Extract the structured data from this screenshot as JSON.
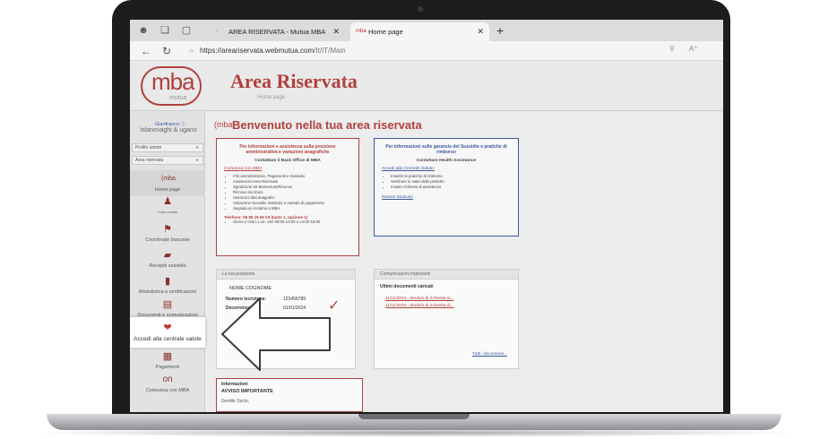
{
  "browser": {
    "tabs": [
      {
        "label": "AREA RISERVATA - Mutua MBA",
        "active": false
      },
      {
        "label": "Home page",
        "active": true
      }
    ],
    "url_domain": "https://areariservata.webmutua.com",
    "url_path": "/It/IT/Main"
  },
  "header": {
    "logo_text": "mba",
    "logo_sub": "mutua",
    "title": "Area Riservata",
    "subtitle": "Home page"
  },
  "sidebar": {
    "user_name": "Gianfranco ⓘ",
    "user_org": "Islanovaghi & ugano",
    "select_profile": "Profilo utente",
    "select_area": "Area riservata",
    "items": [
      {
        "label": "Home page",
        "icon": "mba-icon"
      },
      {
        "label": "Il mio nucleo",
        "icon": "people-icon"
      },
      {
        "label": "Coordinate bancarie",
        "icon": "bank-icon"
      },
      {
        "label": "Recapiti sussidio",
        "icon": "money-icon"
      },
      {
        "label": "Modulistica e certificazioni",
        "icon": "document-icon"
      },
      {
        "label": "Documenti e comunicazioni",
        "icon": "folder-icon"
      },
      {
        "label": "Accedi alla centrale salute",
        "icon": "health-icon"
      },
      {
        "label": "Pagamenti",
        "icon": "payment-icon"
      },
      {
        "label": "Comunica con MBA",
        "icon": "chat-icon"
      }
    ]
  },
  "content": {
    "welcome": "Benvenuto nella tua area riservata",
    "box_red": {
      "title": "Per informazioni e assistenza sulla posizione amministrativa e variazioni anagrafiche",
      "subtitle": "Contattare il Back Office di MBA",
      "link": "Comunica con MBA",
      "bullets": [
        "Info amministrative, Pagamenti e Sussidio",
        "Assistenza Area Riservata",
        "Spedizione Kit Benvenuto/Rinnovo",
        "Rinnovo iscrizioni",
        "Variazioni dati anagrafici",
        "Variazione Sussidio Sanitario e metodo di pagamento",
        "Segnala un reclamo a MBA"
      ],
      "phone": "Telefono: 06 86 19 65 03 (tasto 1, opzione 1)",
      "hours": "Giorni e Orari: Lun- Ven 09:00-13:00 e 14:00-18:00"
    },
    "box_blue": {
      "title": "Per informazioni sulle garanzie del Sussidio e pratiche di rimborso",
      "subtitle": "Contattare Health Assistance",
      "link": "Accedi alla Centrale Salute:",
      "bullets": [
        "Inserire le pratiche di rimborso",
        "Verificare lo stato delle pratiche",
        "Inviare richieste di assistenza"
      ],
      "numbers": "Numeri dedicato"
    },
    "position": {
      "head": "La tua posizione",
      "name": "NOME COGNOME",
      "fields": [
        {
          "label": "Numero iscrizione:",
          "value": "123456789"
        },
        {
          "label": "Decorrenza:",
          "value": "01/01/2024"
        }
      ]
    },
    "communications": {
      "head": "Comunicazioni importanti",
      "title": "Ultimi documenti caricati",
      "items": [
        "11/11/2024 - Modulo di richiesta in...",
        "11/11/2024 - Modulo di richiesta di..."
      ],
      "all_link": "Tutti i documenti..."
    },
    "info": {
      "head": "Informazioni",
      "title": "AVVISO IMPORTANTE",
      "text": "Gentile Socio,"
    }
  }
}
